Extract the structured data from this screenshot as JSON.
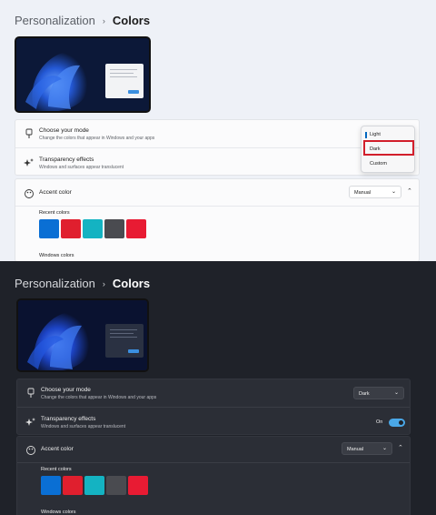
{
  "breadcrumb": {
    "parent": "Personalization",
    "separator": "›",
    "current": "Colors"
  },
  "light_panel": {
    "mode_row": {
      "title": "Choose your mode",
      "subtitle": "Change the colors that appear in Windows and your apps",
      "icon": "brush-icon"
    },
    "mode_dropdown": {
      "options": [
        "Light",
        "Dark",
        "Custom"
      ],
      "highlighted": "Dark",
      "current": "Light"
    },
    "transparency_row": {
      "title": "Transparency effects",
      "subtitle": "Windows and surfaces appear translucent",
      "icon": "sparkle-icon"
    },
    "accent_row": {
      "title": "Accent color",
      "select_value": "Manual",
      "icon": "palette-icon"
    },
    "recent_colors_label": "Recent colors",
    "windows_colors_label": "Windows colors"
  },
  "dark_panel": {
    "mode_row": {
      "title": "Choose your mode",
      "subtitle": "Change the colors that appear in Windows and your apps",
      "select_value": "Dark",
      "icon": "brush-icon"
    },
    "transparency_row": {
      "title": "Transparency effects",
      "subtitle": "Windows and surfaces appear translucent",
      "toggle_label": "On",
      "toggle_on": true,
      "icon": "sparkle-icon"
    },
    "accent_row": {
      "title": "Accent color",
      "select_value": "Manual",
      "icon": "palette-icon"
    },
    "recent_colors_label": "Recent colors",
    "windows_colors_label": "Windows colors"
  },
  "recent_colors": [
    "#0a6fd4",
    "#e01f2e",
    "#14b3c2",
    "#4a4b50",
    "#e81b33"
  ],
  "icons": {
    "chevron_down": "⌄",
    "chevron_up": "⌃"
  }
}
